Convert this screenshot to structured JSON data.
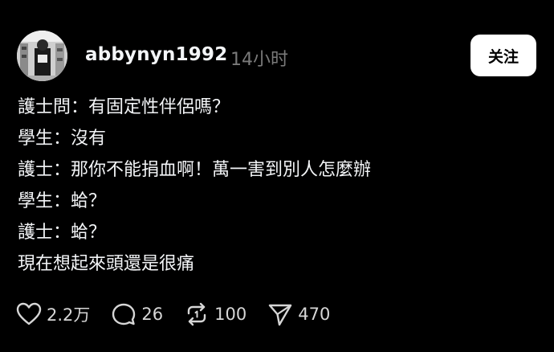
{
  "post": {
    "username": "abbynyn1992",
    "timestamp": "14小时",
    "follow_label": "关注",
    "lines": [
      "護士問：有固定性伴侶嗎？",
      "學生：沒有",
      "護士：那你不能捐血啊！萬一害到別人怎麼辦",
      "學生：蛤？",
      "護士：蛤？",
      "現在想起來頭還是很痛"
    ]
  },
  "actions": {
    "likes": "2.2万",
    "comments": "26",
    "reposts": "100",
    "shares": "470"
  },
  "icons": {
    "like": "heart-icon",
    "comment": "comment-bubble-icon",
    "repost": "repost-icon",
    "share": "send-icon"
  },
  "colors": {
    "background": "#000000",
    "text": "#f3f5f7",
    "muted": "#7a7a7a",
    "button_bg": "#ffffff",
    "button_text": "#000000"
  }
}
